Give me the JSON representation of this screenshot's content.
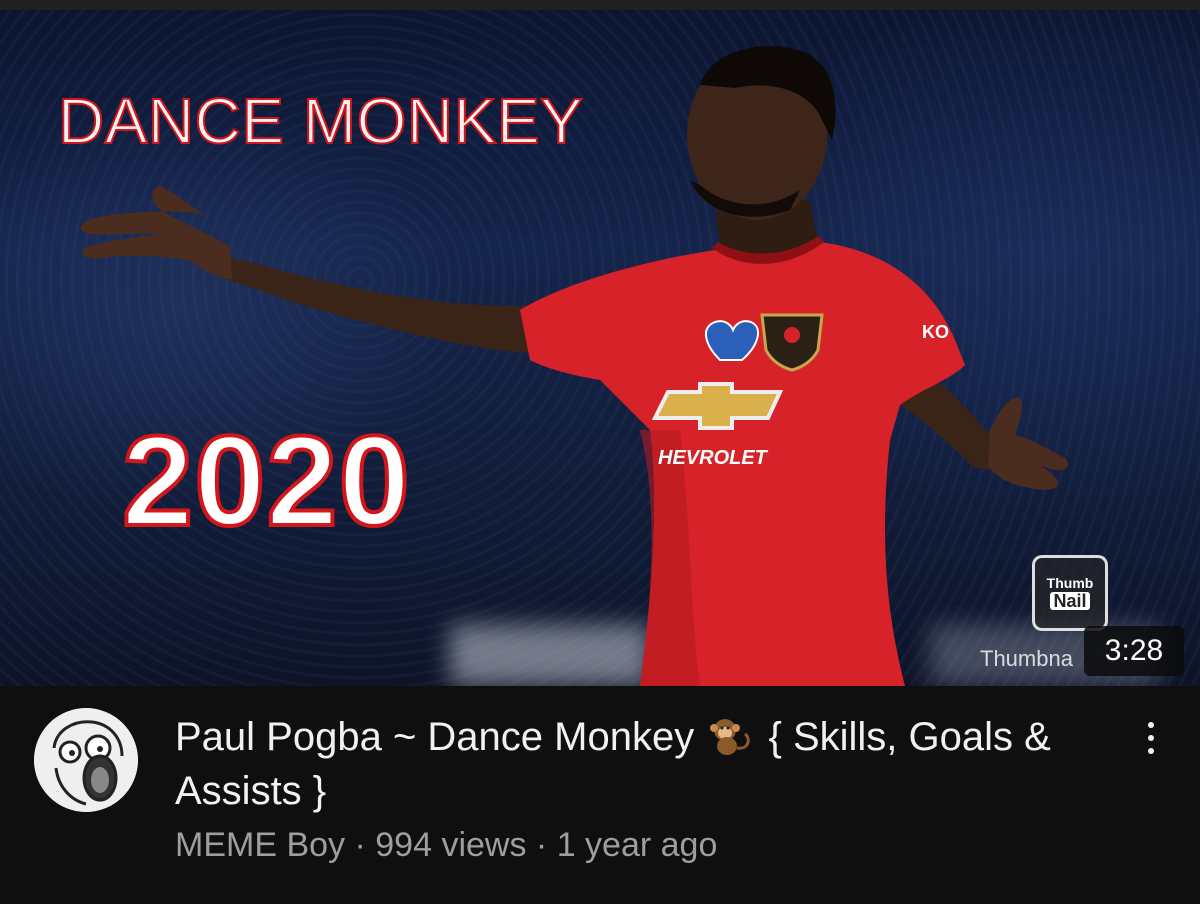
{
  "thumbnail": {
    "overlay_title": "DANCE MONKEY",
    "overlay_year": "2020",
    "sponsor_text": "HEVROLET",
    "sleeve_text": "KO",
    "watermark_badge_line1": "Thumb",
    "watermark_badge_line2": "Nail",
    "watermark_text": "Thumbna",
    "duration": "3:28"
  },
  "video": {
    "title": "Paul Pogba ~ Dance Monkey 🐒 { Skills, Goals & Assists }",
    "title_part1": "Paul Pogba ~ Dance Monkey",
    "title_part2": "{ Skills, Goals & Assists }",
    "title_icon": "monkey-emoji",
    "channel": "MEME Boy",
    "views": "994 views",
    "age": "1 year ago",
    "separator": " · "
  },
  "colors": {
    "background": "#0f0f0f",
    "jersey_red": "#d8222a",
    "overlay_stroke": "#d4161b",
    "subtext": "#9e9e9e"
  }
}
